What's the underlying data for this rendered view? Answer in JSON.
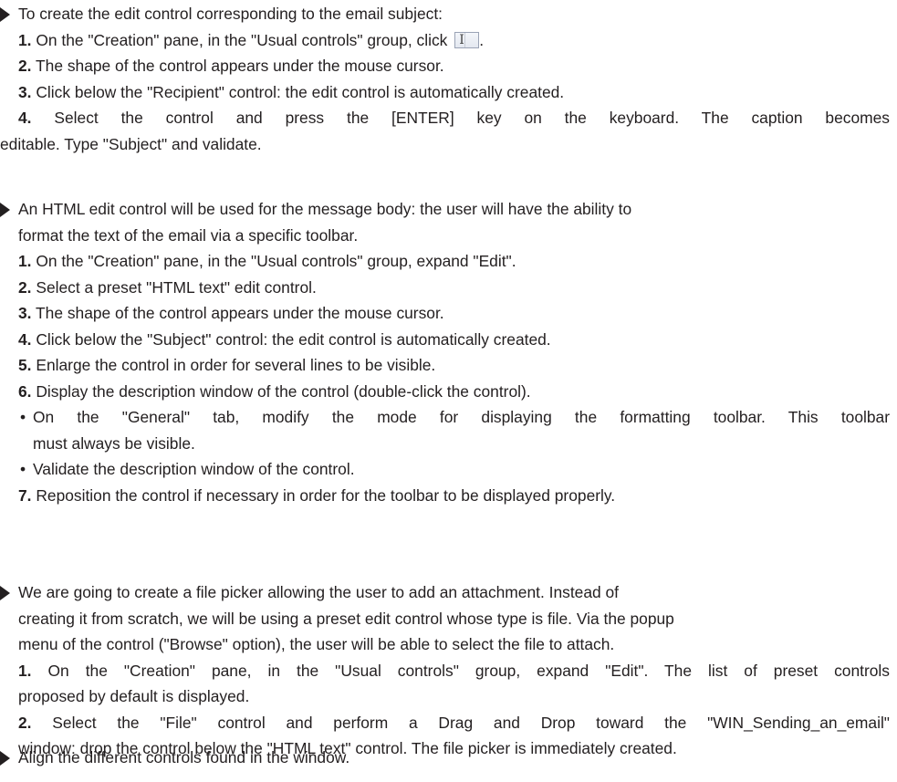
{
  "sections": [
    {
      "intro": "To create the edit control corresponding to the email subject:",
      "steps": [
        {
          "num": "1.",
          "text_before_icon": " On the \"Creation\" pane, in the \"Usual controls\" group, click ",
          "text_after_icon": "."
        },
        {
          "num": "2.",
          "text": " The shape of the control appears under the mouse cursor."
        },
        {
          "num": "3.",
          "text": " Click below the \"Recipient\" control: the edit control is automatically created."
        },
        {
          "num": "4.",
          "text_line1": " Select the control and press the [ENTER] key on the keyboard. The caption becomes",
          "text_line2": "editable. Type \"Subject\" and validate."
        }
      ]
    },
    {
      "intro_line1": "An HTML edit control will be used for the message body: the user will have the ability to",
      "intro_line2": "format the text of the email via a specific toolbar.",
      "steps": [
        {
          "num": "1.",
          "text": " On the \"Creation\" pane, in the \"Usual controls\" group, expand \"Edit\"."
        },
        {
          "num": "2.",
          "text": " Select a preset \"HTML text\" edit control."
        },
        {
          "num": "3.",
          "text": " The shape of the control appears under the mouse cursor."
        },
        {
          "num": "4.",
          "text": " Click below the \"Subject\" control: the edit control is automatically created."
        },
        {
          "num": "5.",
          "text": " Enlarge the control in order for several lines to be visible."
        },
        {
          "num": "6.",
          "text": " Display the description window of the control (double-click the control)."
        }
      ],
      "bullets": [
        {
          "dot": "•",
          "line1": "On the \"General\" tab, modify the mode for displaying the formatting toolbar. This toolbar",
          "line2": "must always be visible."
        },
        {
          "dot": "•",
          "line1": "Validate the description window of the control."
        }
      ],
      "final_step": {
        "num": "7.",
        "text": " Reposition the control if necessary in order for the toolbar to be displayed properly."
      }
    },
    {
      "intro_line1": "We are going to create a file picker allowing the user to add an attachment. Instead of",
      "intro_line2": "creating it from scratch, we will be using a preset edit control whose type is file. Via the popup",
      "intro_line3": "menu of the control (\"Browse\" option), the user will be able to select the file to attach.",
      "steps": [
        {
          "num": "1.",
          "text_line1": " On the \"Creation\" pane, in the \"Usual controls\" group, expand \"Edit\". The list of preset controls",
          "text_line2": "proposed by default is displayed."
        },
        {
          "num": "2.",
          "text_line1": " Select the \"File\" control and perform a Drag and Drop toward the \"WIN_Sending_an_email\"",
          "text_line2": "window: drop the control below the \"HTML text\" control. The file picker is immediately created."
        }
      ]
    },
    {
      "intro": "Align the different controls found in the window."
    }
  ],
  "icons": {
    "section_marker": "right-triangle-arrow",
    "inline_control": "edit-control-icon"
  }
}
